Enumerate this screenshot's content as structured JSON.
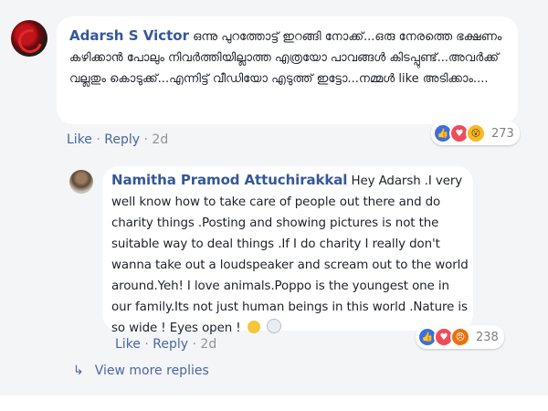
{
  "comment1": {
    "author": "Adarsh S Victor",
    "text": "ഒന്നു പുറത്തോട്ട് ഇറങ്ങി നോക്ക്...ഒരു നേരത്തെ ഭക്ഷണം കഴിക്കാൻ പോലും നിവർത്തിയില്ലാത്ത എത്രയോ പാവങ്ങൾ കിടപ്പുണ്ട്...അവർക്ക് വല്ലതും കൊടുക്ക്...എന്നിട്ട് വീഡിയോ എടുത്ത് ഇട്ടോ...നമ്മൾ like അടിക്കാം....",
    "like_label": "Like",
    "reply_label": "Reply",
    "time": "2d",
    "reactions": [
      "like",
      "love",
      "wow"
    ],
    "reaction_count": "273"
  },
  "comment2": {
    "author": "Namitha Pramod Attuchirakkal",
    "text": "Hey Adarsh .I very well know how to take care of people out there and do charity things .Posting and showing pictures is not the suitable way to deal things .If I do charity I really don't wanna take out a loudspeaker and scream out to the world around.Yeh! I love animals.Poppo is the youngest one in our family.Its not just human beings in this world .Nature is so wide ! Eyes open !",
    "like_label": "Like",
    "reply_label": "Reply",
    "time": "2d",
    "reactions": [
      "like",
      "love",
      "angry"
    ],
    "reaction_count": "238"
  },
  "view_more": "View more replies",
  "separator": "·",
  "colors": {
    "link": "#365899",
    "action": "#4b67a1",
    "panel": "#f4f5f7",
    "like": "#3b6fe0",
    "love": "#f04b5a"
  }
}
